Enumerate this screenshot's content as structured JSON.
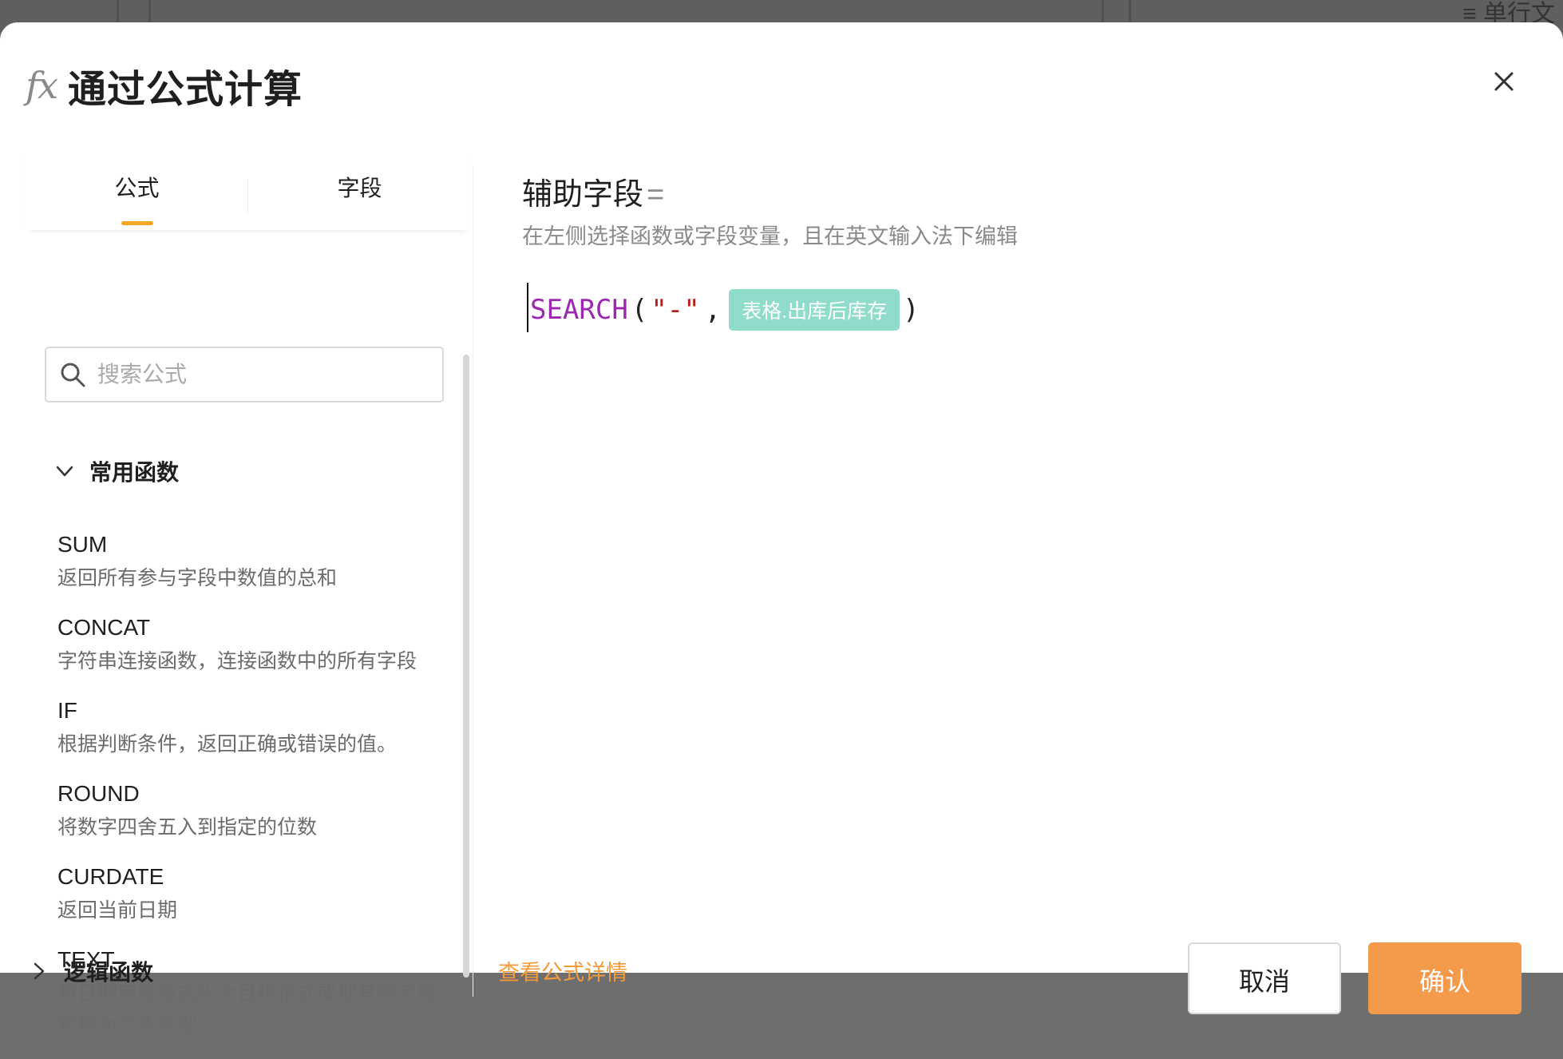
{
  "backdrop": {
    "tail_text": "≡ 单行文"
  },
  "dialog": {
    "icon": "fx-icon",
    "title": "通过公式计算",
    "close_icon": "close-icon"
  },
  "left_panel": {
    "tabs": [
      {
        "label": "公式",
        "active": true
      },
      {
        "label": "字段",
        "active": false
      }
    ],
    "search": {
      "placeholder": "搜索公式",
      "value": ""
    },
    "groups": [
      {
        "label": "常用函数",
        "expanded": true,
        "functions": [
          {
            "name": "SUM",
            "desc": "返回所有参与字段中数值的总和"
          },
          {
            "name": "CONCAT",
            "desc": "字符串连接函数，连接函数中的所有字段"
          },
          {
            "name": "IF",
            "desc": "根据判断条件，返回正确或错误的值。"
          },
          {
            "name": "ROUND",
            "desc": "将数字四舍五入到指定的位数"
          },
          {
            "name": "CURDATE",
            "desc": "返回当前日期"
          },
          {
            "name": "TEXT",
            "desc": "将日期字段格式化为目标格式或把其他字段转换为文本类型"
          }
        ]
      },
      {
        "label": "逻辑函数",
        "expanded": false
      }
    ]
  },
  "editor": {
    "field_name": "辅助字段",
    "equals": "=",
    "hint": "在左侧选择函数或字段变量，且在英文输入法下编辑",
    "formula": {
      "function": "SEARCH",
      "open_paren": "(",
      "string_arg": "\"-\"",
      "comma": ",",
      "field_chip": "表格.出库后库存",
      "close_paren": ")"
    },
    "colors": {
      "function": "#9c27b0",
      "string": "#b71c1c",
      "chip": "#8fdccb"
    }
  },
  "footer": {
    "detail_link": "查看公式详情",
    "cancel_label": "取消",
    "confirm_label": "确认",
    "accent": "#f39b4a"
  }
}
